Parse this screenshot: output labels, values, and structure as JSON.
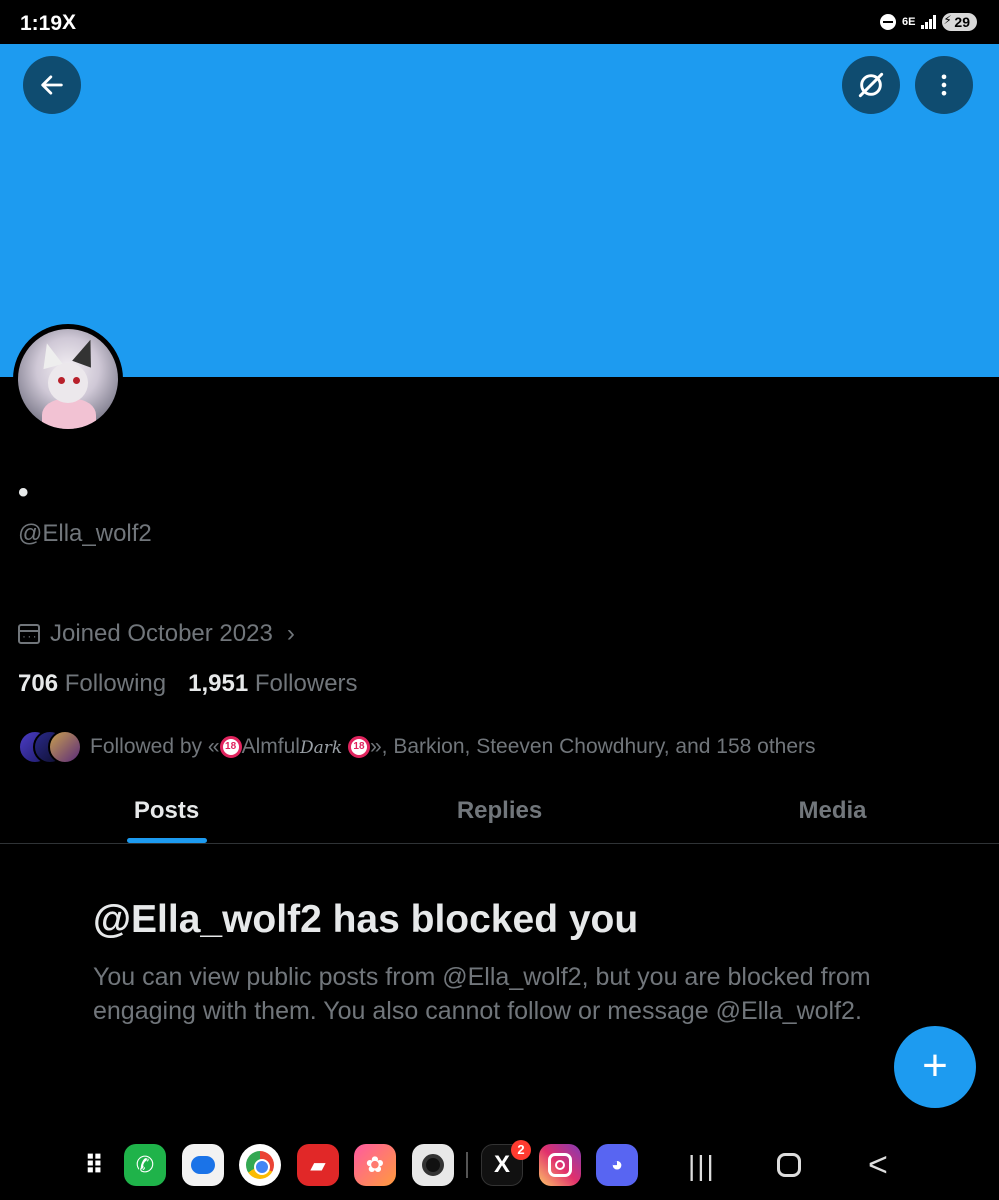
{
  "status_bar": {
    "time": "1:19",
    "x_icon": "X",
    "wifi_label": "6E",
    "battery": "29"
  },
  "header": {
    "back_icon": "←",
    "incognito_icon": "∅",
    "more_icon": "⋮",
    "banner_color": "#1d9bf0"
  },
  "profile": {
    "display_name": "•",
    "handle": "@Ella_wolf2",
    "joined": "Joined October 2023",
    "following_count": "706",
    "following_label": "Following",
    "followers_count": "1,951",
    "followers_label": "Followers",
    "followed_by_prefix": "Followed by «",
    "followed_by_name_a": "Almful",
    "followed_by_name_b": "Dark",
    "followed_by_rest": "», Barkion, Steeven Chowdhury, and 158 others",
    "r18_label": "18"
  },
  "tabs": [
    {
      "label": "Posts"
    },
    {
      "label": "Replies"
    },
    {
      "label": "Media"
    }
  ],
  "blocked": {
    "title": "@Ella_wolf2 has blocked you",
    "body": "You can view public posts from @Ella_wolf2, but you are blocked from engaging with them. You also cannot follow or message @Ella_wolf2."
  },
  "fab": {
    "icon": "+"
  },
  "dock": {
    "apps_icon": "⠿",
    "phone_icon": "✆",
    "x_app": "X",
    "x_badge": "2",
    "flower_icon": "✿",
    "flip_icon": "▰",
    "discord_icon": "◕"
  },
  "nav": {
    "recent_icon": "|||",
    "back_icon": "<"
  },
  "colors": {
    "accent": "#1d9bf0",
    "background": "#000000",
    "muted_text": "#71767b"
  }
}
